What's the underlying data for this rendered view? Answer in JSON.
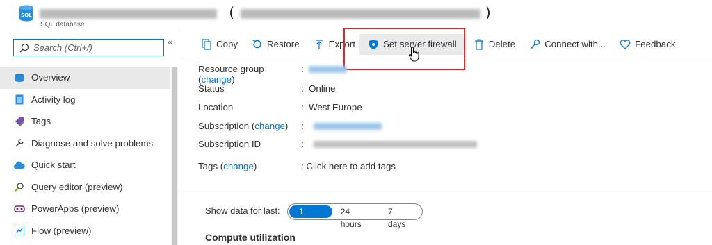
{
  "header": {
    "title_suffix": ")",
    "subtitle": "SQL database"
  },
  "sidebar": {
    "search_placeholder": "Search (Ctrl+/)",
    "collapse": "«",
    "items": [
      {
        "label": "Overview",
        "icon": "sql-database-icon"
      },
      {
        "label": "Activity log",
        "icon": "activity-log-icon"
      },
      {
        "label": "Tags",
        "icon": "tag-icon"
      },
      {
        "label": "Diagnose and solve problems",
        "icon": "wrench-icon"
      },
      {
        "label": "Quick start",
        "icon": "cloud-icon"
      },
      {
        "label": "Query editor (preview)",
        "icon": "query-editor-icon"
      },
      {
        "label": "PowerApps (preview)",
        "icon": "powerapps-icon"
      },
      {
        "label": "Flow (preview)",
        "icon": "flow-icon"
      }
    ]
  },
  "toolbar": {
    "copy": "Copy",
    "restore": "Restore",
    "export": "Export",
    "firewall": "Set server firewall",
    "delete": "Delete",
    "connect": "Connect with...",
    "feedback": "Feedback"
  },
  "essentials": {
    "resource_group_label": "Resource group",
    "change": "change",
    "status_label": "Status",
    "status_value": "Online",
    "location_label": "Location",
    "location_value": "West Europe",
    "subscription_label": "Subscription",
    "subscription_id_label": "Subscription ID",
    "tags_label": "Tags",
    "tags_value": "Click here to add tags",
    "colon": ":"
  },
  "metrics": {
    "show_data_label": "Show data for last:",
    "options": [
      "1 hour",
      "24 hours",
      "7 days"
    ],
    "selected": "1 hour",
    "compute_title": "Compute utilization"
  },
  "colors": {
    "accent": "#0078d4",
    "highlight": "#e0262c"
  }
}
